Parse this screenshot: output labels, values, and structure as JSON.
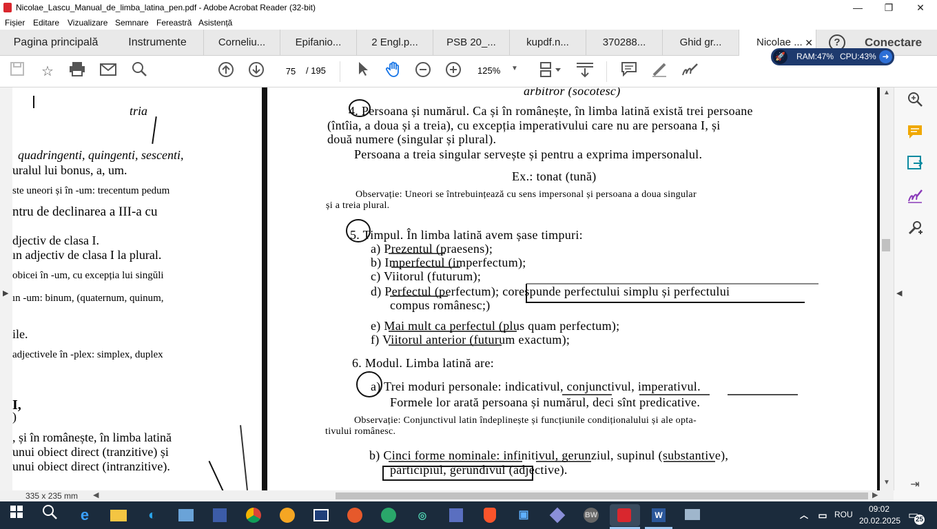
{
  "window": {
    "title": "Nicolae_Lascu_Manual_de_limba_latina_pen.pdf - Adobe Acrobat Reader (32-bit)",
    "minimize": "—",
    "maximize": "❐",
    "close": "✕"
  },
  "menu": [
    "Fișier",
    "Editare",
    "Vizualizare",
    "Semnare",
    "Fereastră",
    "Asistență"
  ],
  "tabs": {
    "home": "Pagina principală",
    "tools": "Instrumente",
    "docs": [
      "Corneliu...",
      "Epifanio...",
      "2 Engl.p...",
      "PSB 20_...",
      "kupdf.n...",
      "370288...",
      "Ghid gr...",
      "Nicolae ..."
    ],
    "active_close": "✕",
    "help": "?",
    "connect": "Conectare"
  },
  "toolbar": {
    "page_current": "75",
    "page_total": "/ 195",
    "zoom": "125%"
  },
  "monitor": {
    "ram": "RAM:47%",
    "cpu": "CPU:43%"
  },
  "page_left": [
    "tria",
    "quadringenti, quingenti, sescenti,",
    "uralul lui bonus, a, um.",
    "ste uneori și în -um: trecentum pedum",
    "ntru de declinarea a III-a cu",
    "djectiv de clasa I.",
    "ın adjectiv de clasa I la plural.",
    "obicei în -um, cu excepția lui singŭli",
    "ın -um: binum, (quaternum, quinum,",
    "ile.",
    "adjectivele în -plex: simplex, duplex",
    "I,",
    ")",
    ", și în românește, în limba latină",
    "unui obiect direct (tranzitive) și",
    "unui obiect direct (intranzitive)."
  ],
  "page_right": [
    "arbitror (socotesc)",
    "4. Persoana și numărul. Ca și în românește, în limba latină există trei persoane",
    "(întîia, a doua și a treia), cu excepția imperativului care nu are persoana I, și",
    "două numere (singular și plural).",
    "Persoana a treia singular servește și pentru a exprima impersonalul.",
    "Ex.: tonat (tună)",
    "Observație: Uneori se întrebuințează cu sens impersonal și persoana a doua singular",
    "și a treia plural.",
    "5. Timpul. În limba latină avem șase timpuri:",
    "a) Prezentul (praesens);",
    "b) Imperfectul (imperfectum);",
    "c) Viitorul (futurum);",
    "d) Perfectul (perfectum); corespunde perfectului simplu și perfectului",
    "compus românesc;)",
    "e) Mai mult ca perfectul (plus quam perfectum);",
    "f) Viitorul anterior (futurum exactum);",
    "6. Modul. Limba latină are:",
    "a) Trei moduri personale: indicativul, conjunctivul, imperativul.",
    "Formele lor arată persoana și numărul, deci sînt predicative.",
    "Observație: Conjunctivul latin îndeplinește și funcțiunile condiționalului și ale opta-",
    "tivului românesc.",
    "b) Cinci forme nominale: infinitivul, gerunziul, supinul (substantive),",
    "participiul, gerundivul (adjective)."
  ],
  "status": {
    "dimensions": "335 x 235 mm"
  },
  "taskbar": {
    "lang": "ROU",
    "time": "09:02",
    "date": "20.02.2025",
    "notif_count": "25"
  },
  "colors": {
    "acrobat_red": "#d9272e",
    "taskbar": "#1b2b3c",
    "monitor": "#1e3a6e"
  }
}
